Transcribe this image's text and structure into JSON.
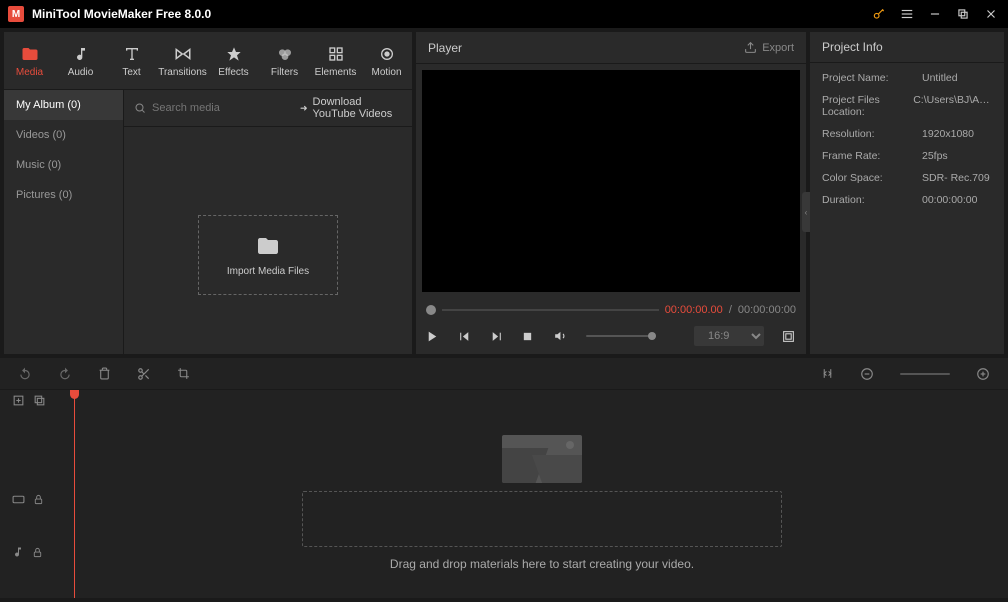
{
  "titlebar": {
    "title": "MiniTool MovieMaker Free 8.0.0"
  },
  "tabs": [
    {
      "label": "Media",
      "active": true
    },
    {
      "label": "Audio"
    },
    {
      "label": "Text"
    },
    {
      "label": "Transitions"
    },
    {
      "label": "Effects"
    },
    {
      "label": "Filters"
    },
    {
      "label": "Elements"
    },
    {
      "label": "Motion"
    }
  ],
  "sidebar": [
    {
      "label": "My Album (0)",
      "active": true
    },
    {
      "label": "Videos (0)"
    },
    {
      "label": "Music (0)"
    },
    {
      "label": "Pictures (0)"
    }
  ],
  "media": {
    "search_placeholder": "Search media",
    "download_label": "Download YouTube Videos",
    "import_label": "Import Media Files"
  },
  "player": {
    "title": "Player",
    "export_label": "Export",
    "time_current": "00:00:00.00",
    "time_total": "00:00:00:00",
    "aspect": "16:9"
  },
  "project": {
    "title": "Project Info",
    "rows": [
      {
        "label": "Project Name:",
        "value": "Untitled"
      },
      {
        "label": "Project Files Location:",
        "value": "C:\\Users\\BJ\\App..."
      },
      {
        "label": "Resolution:",
        "value": "1920x1080"
      },
      {
        "label": "Frame Rate:",
        "value": "25fps"
      },
      {
        "label": "Color Space:",
        "value": "SDR- Rec.709"
      },
      {
        "label": "Duration:",
        "value": "00:00:00:00"
      }
    ]
  },
  "timeline": {
    "drop_text": "Drag and drop materials here to start creating your video."
  }
}
